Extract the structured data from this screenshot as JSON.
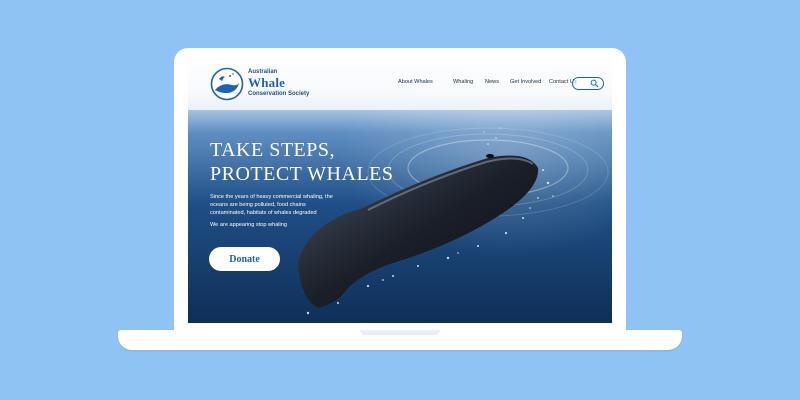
{
  "brand": {
    "line1": "Australian",
    "line2": "Whale",
    "line3": "Conservation Society"
  },
  "nav": {
    "items": [
      {
        "label": "About Whales"
      },
      {
        "label": "Whaling"
      },
      {
        "label": "News"
      },
      {
        "label": "Get Involved"
      },
      {
        "label": "Contact Us"
      }
    ]
  },
  "search": {
    "icon": "search-icon"
  },
  "hero": {
    "headline_line1": "TAKE STEPS,",
    "headline_line2": "PROTECT WHALES",
    "paragraph": "Since the years of heavy commercial whaling, the oceans are being polluted, food chains contaminated, habitats of whales degraded",
    "paragraph2": "We are appearing stop whaling",
    "donate_label": "Donate"
  },
  "colors": {
    "background": "#8ec3f3",
    "accent": "#1d63b3",
    "ocean_dark": "#0d2f55",
    "ocean_light": "#cfe0f2"
  }
}
